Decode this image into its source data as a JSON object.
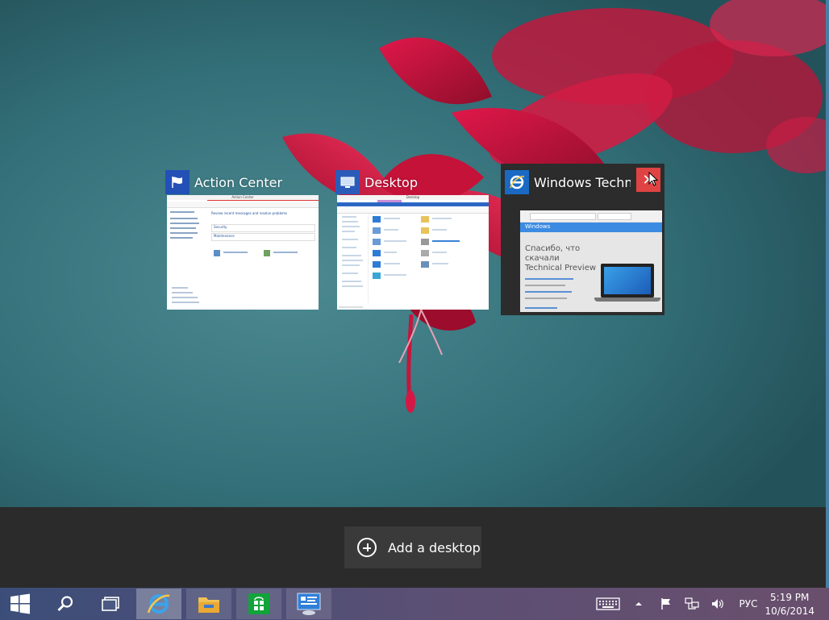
{
  "task_view": {
    "windows": [
      {
        "title": "Action Center",
        "icon": "flag-icon"
      },
      {
        "title": "Desktop",
        "icon": "desktop-icon"
      },
      {
        "title": "Windows Techni…",
        "icon": "internet-explorer-icon"
      }
    ],
    "action_center_thumb": {
      "window_title": "Action Center",
      "heading": "Review recent messages and resolve problems",
      "security": "Security",
      "maintenance": "Maintenance"
    },
    "desktop_thumb": {
      "window_title": "Desktop"
    },
    "ie_thumb": {
      "logo": "Windows",
      "headline_1": "Спасибо, что",
      "headline_2": "скачали",
      "headline_3": "Technical Preview"
    },
    "add_desktop": {
      "label": "Add a desktop"
    }
  },
  "taskbar": {
    "start": "start-icon",
    "search": "search-icon",
    "task_view": "task-view-icon",
    "apps": [
      {
        "name": "internet-explorer",
        "icon": "internet-explorer-icon"
      },
      {
        "name": "file-explorer",
        "icon": "folder-icon"
      },
      {
        "name": "store",
        "icon": "store-icon"
      },
      {
        "name": "control-panel",
        "icon": "control-panel-icon"
      }
    ],
    "tray": {
      "keyboard": "keyboard-icon",
      "show_hidden": "chevron-up-icon",
      "flag": "action-center-flag-icon",
      "network": "network-icon",
      "volume": "volume-icon",
      "language": "РУС"
    },
    "clock": {
      "time": "5:19 PM",
      "date": "10/6/2014"
    }
  },
  "colors": {
    "taskbar_start": "#3b4e79",
    "taskbar_end": "#6a4f6d",
    "taskview_bar": "#2b2b2b",
    "close_button": "#e04343",
    "flower": "#c8143a"
  }
}
